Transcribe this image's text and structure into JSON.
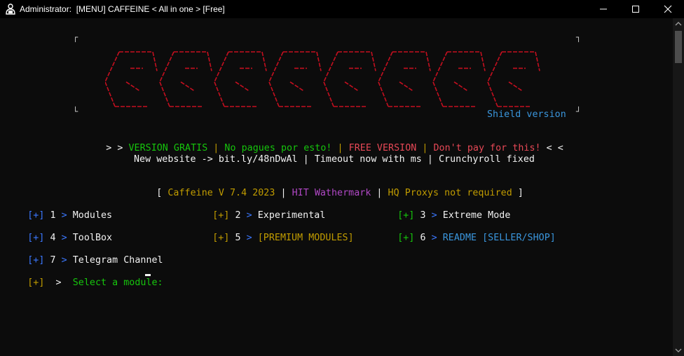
{
  "window": {
    "title": "Administrator:  [MENU] CAFFEINE < All in one > [Free]",
    "icons": {
      "app": "terminal-admin-icon",
      "minimize": "minimize-icon",
      "maximize": "maximize-icon",
      "close": "close-icon"
    }
  },
  "banner": {
    "ascii_text": "CAFFEINE",
    "ascii_color": "#c50f1f",
    "shield_label": "Shield version"
  },
  "version_line": {
    "prefix": "> > ",
    "gratis": "VERSION GRATIS",
    "sep1": " | ",
    "no_pagues": "No pagues por esto!",
    "sep2": " | ",
    "free": "FREE VERSION",
    "sep3": " | ",
    "dont_pay": "Don't pay for this!",
    "suffix": " < <"
  },
  "news_line": "New website -> bit.ly/48nDwAl | Timeout now with ms | Crunchyroll fixed",
  "info_line": {
    "open": "[ ",
    "caffeine": "Caffeine V 7.4 2023",
    "sep1": " | ",
    "hit": "HIT Wathermark",
    "sep2": " | ",
    "hq": "HQ Proxys not required",
    "close": " ]"
  },
  "menu": {
    "bullet": "[+]",
    "arrow": ">",
    "items": [
      {
        "num": "1",
        "label": "Modules"
      },
      {
        "num": "2",
        "label": "Experimental"
      },
      {
        "num": "3",
        "label": "Extreme Mode"
      },
      {
        "num": "4",
        "label": "ToolBox"
      },
      {
        "num": "5",
        "label": "[PREMIUM MODULES]"
      },
      {
        "num": "6",
        "label": "README [SELLER/SHOP]"
      },
      {
        "num": "7",
        "label": "Telegram Channel"
      }
    ]
  },
  "prompt": {
    "bullet": "[+]",
    "arrow": ">",
    "text": "Select a module:"
  },
  "colors": {
    "background": "#0c0c0c",
    "bracket_blue": "#3b78ff",
    "green": "#16c60c",
    "red": "#e74856",
    "orange": "#c19c00",
    "purple": "#b148c6",
    "cyan": "#3a96dd"
  }
}
